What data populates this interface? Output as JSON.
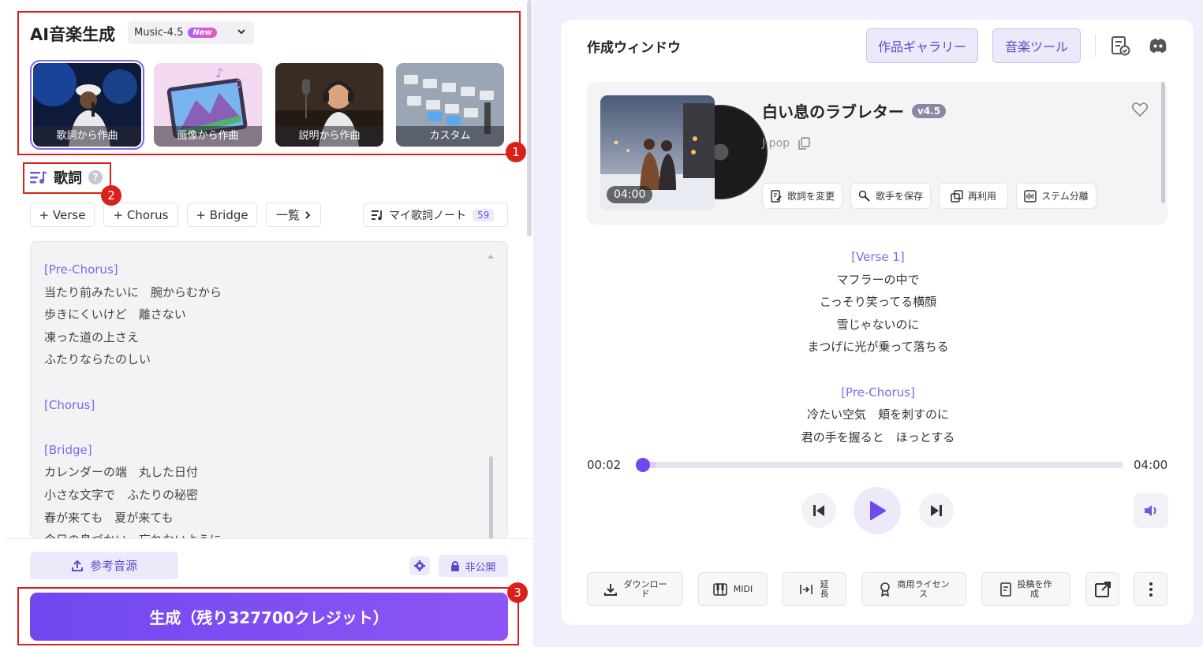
{
  "left": {
    "brand": "AI音楽生成",
    "model": {
      "name": "Music-4.5",
      "badge": "New"
    },
    "modes": [
      {
        "label": "歌詞から作曲",
        "selected": true
      },
      {
        "label": "画像から作曲",
        "selected": false
      },
      {
        "label": "説明から作曲",
        "selected": false
      },
      {
        "label": "カスタム",
        "selected": false
      }
    ],
    "lyrics_title": "歌詞",
    "help": "?",
    "chips": {
      "verse": "+ Verse",
      "chorus": "+ Chorus",
      "bridge": "+ Bridge",
      "list": "一覧"
    },
    "note": {
      "label": "マイ歌詞ノート",
      "count": "59"
    },
    "lyrics_lines": [
      {
        "text": "[Pre-Chorus]",
        "tag": true
      },
      {
        "text": "当たり前みたいに　腕からむから",
        "tag": false
      },
      {
        "text": "歩きにくいけど　離さない",
        "tag": false
      },
      {
        "text": "凍った道の上さえ",
        "tag": false
      },
      {
        "text": "ふたりならたのしい",
        "tag": false
      },
      {
        "text": "",
        "tag": false
      },
      {
        "text": "[Chorus]",
        "tag": true
      },
      {
        "text": "",
        "tag": false
      },
      {
        "text": "[Bridge]",
        "tag": true
      },
      {
        "text": "カレンダーの端　丸した日付",
        "tag": false
      },
      {
        "text": "小さな文字で　ふたりの秘密",
        "tag": false
      },
      {
        "text": "春が来ても　夏が来ても",
        "tag": false
      },
      {
        "text": "今日の息づかい　忘れないように",
        "tag": false
      }
    ],
    "ref_audio": "参考音源",
    "private": "非公開",
    "generate": "生成（残り327700クレジット）",
    "markers": [
      "1",
      "2",
      "3"
    ]
  },
  "right": {
    "window_title": "作成ウィンドウ",
    "gallery_btn": "作品ギャラリー",
    "tools_btn": "音楽ツール",
    "song": {
      "title": "白い息のラブレター",
      "version": "v4.5",
      "genre": "J-pop",
      "duration": "04:00",
      "actions": [
        "歌詞を変更",
        "歌手を保存",
        "再利用",
        "ステム分離"
      ]
    },
    "lyrics": [
      {
        "text": "[Verse 1]",
        "tag": true
      },
      {
        "text": "マフラーの中で",
        "tag": false
      },
      {
        "text": "こっそり笑ってる横顔",
        "tag": false
      },
      {
        "text": "雪じゃないのに",
        "tag": false
      },
      {
        "text": "まつげに光が乗って落ちる",
        "tag": false
      },
      {
        "text": "",
        "tag": false
      },
      {
        "text": "[Pre-Chorus]",
        "tag": true
      },
      {
        "text": "冷たい空気　頬を刺すのに",
        "tag": false
      },
      {
        "text": "君の手を握ると　ほっとする",
        "tag": false
      }
    ],
    "player": {
      "current": "00:02",
      "total": "04:00",
      "progress": 0.01,
      "buffered": 0.04
    },
    "bottom": {
      "download": [
        "ダウンロー",
        "ド"
      ],
      "midi": "MIDI",
      "extend": [
        "延",
        "長"
      ],
      "license": [
        "商用ライセン",
        "ス"
      ],
      "post": [
        "投稿を作",
        "成"
      ]
    }
  },
  "colors": {
    "accent": "#7048f0",
    "highlight": "#d9211b",
    "panel": "#f0effc"
  }
}
